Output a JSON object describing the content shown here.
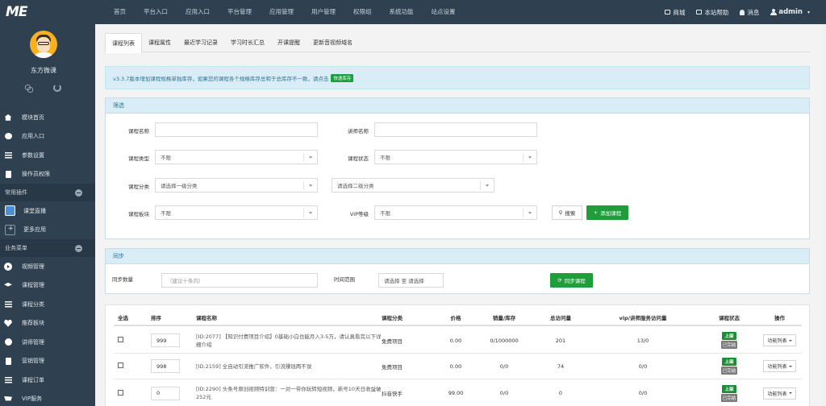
{
  "topnav": {
    "logo": "ME",
    "items": [
      "首页",
      "平台入口",
      "应用入口",
      "平台管理",
      "应用管理",
      "用户管理",
      "权限组",
      "系统功能",
      "站点设置"
    ],
    "right": {
      "shop": "商城",
      "help": "本站帮助",
      "messages": "消息",
      "user": "admin"
    }
  },
  "sidebar": {
    "profile_name": "东方微课",
    "items_top": [
      "模块首页",
      "应用入口",
      "参数设置",
      "操作员权限"
    ],
    "group1": "常用插件",
    "plugins": [
      "课堂直播",
      "更多应用"
    ],
    "group2": "业务菜单",
    "business": [
      "视频管理",
      "课程管理",
      "课程分类",
      "推荐板块",
      "讲师管理",
      "营销管理",
      "课程订单",
      "VIP服务"
    ]
  },
  "tabs": [
    "课程列表",
    "课程属性",
    "最近学习记录",
    "学习时长汇总",
    "开课提醒",
    "更新音视频域名"
  ],
  "notice": {
    "text": "v3.3.7版本增加课程规格单独库存，如果您的课程各个规格库存总和于总库存不一致，请点击",
    "button": "快速库存"
  },
  "filter": {
    "title": "筛选",
    "course_name_label": "课程名称",
    "teacher_label": "讲师名称",
    "type_label": "课程类型",
    "type_value": "不限",
    "status_label": "课程状态",
    "status_value": "不限",
    "category_label": "课程分类",
    "cat1_placeholder": "请选择一级分类",
    "cat2_placeholder": "请选择二级分类",
    "block_label": "课程板块",
    "block_value": "不限",
    "vip_label": "VIP等级",
    "vip_value": "不限",
    "search_btn": "搜索",
    "add_btn": "添加课程"
  },
  "sync": {
    "title": "同步",
    "count_label": "同步数量",
    "count_placeholder": "（建议十条内）",
    "range_label": "时间范围",
    "range_value": "请选择 至 请选择",
    "sync_btn": "同步课程"
  },
  "table": {
    "headers": [
      "全选",
      "排序",
      "课程名称",
      "课程分类",
      "价格",
      "销量/库存",
      "总访问量",
      "vip/讲师服务访问量",
      "课程状态",
      "操作"
    ],
    "rows": [
      {
        "sort": "999",
        "name": "[ID:2077] 【知识付费项目介绍】0基础小白也能月入3-5万，请认真看完以下详细介绍",
        "category": "免费项目",
        "price": "0.00",
        "stock": "0/1000000",
        "visits": "201",
        "vip": "13/0",
        "status": "上架",
        "bind": "已完结",
        "op": "功能列表"
      },
      {
        "sort": "998",
        "name": "[ID:2159] 全自动引流推广软件，引流赚钱两不误",
        "category": "免费项目",
        "price": "0.00",
        "stock": "0/0",
        "visits": "74",
        "vip": "0/0",
        "status": "上架",
        "bind": "已完结",
        "op": "功能列表"
      },
      {
        "sort": "0",
        "name": "[ID:2290] 头条号原创视频特训营：一对一带你玩转短视频，新号10天日收益破252元",
        "category": "抖音快手",
        "price": "99.00",
        "stock": "0/0",
        "visits": "0",
        "vip": "0/0",
        "status": "上架",
        "bind": "已完结",
        "op": "功能列表"
      }
    ]
  }
}
